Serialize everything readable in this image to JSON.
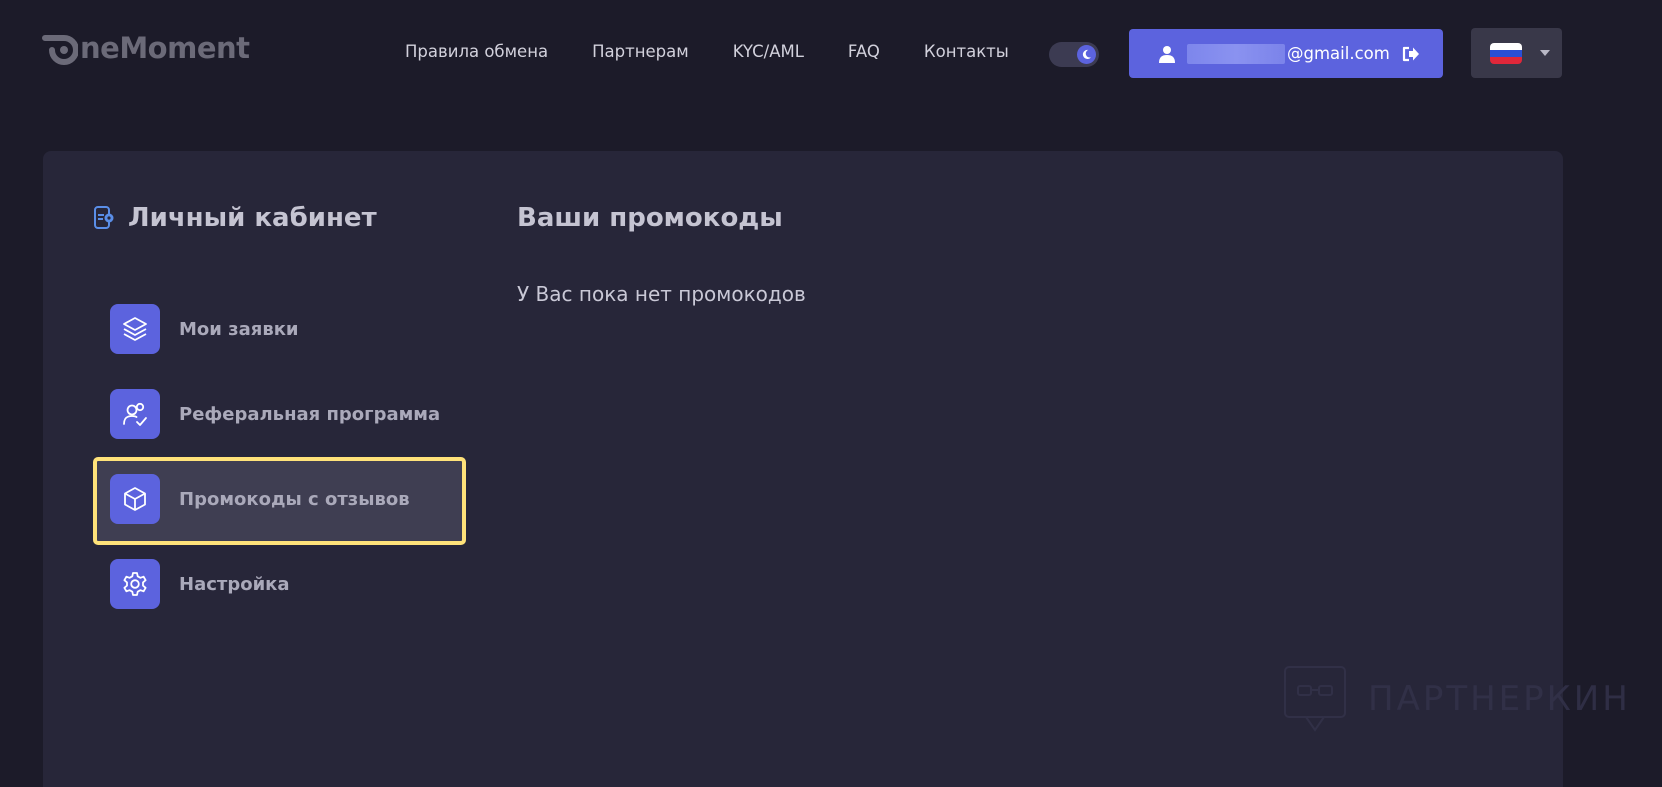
{
  "header": {
    "logo_text": "neMoment",
    "nav": [
      "Правила обмена",
      "Партнерам",
      "KYC/AML",
      "FAQ",
      "Контакты"
    ],
    "theme_toggle": "moon-icon",
    "user": {
      "email_suffix": "@gmail.com"
    },
    "language": "ru"
  },
  "sidebar": {
    "title": "Личный кабинет",
    "items": [
      {
        "label": "Мои заявки",
        "icon": "layers-icon"
      },
      {
        "label": "Реферальная программа",
        "icon": "users-check-icon"
      },
      {
        "label": "Промокоды с отзывов",
        "icon": "box-icon",
        "active": true
      },
      {
        "label": "Настройка",
        "icon": "gear-icon"
      }
    ]
  },
  "main": {
    "title": "Ваши промокоды",
    "empty_text": "У Вас пока нет промокодов"
  },
  "watermark": {
    "text": "ПАРТНЕРКИН"
  },
  "colors": {
    "accent": "#5c63de",
    "background": "#1c1b29",
    "card": "#272639",
    "highlight_border": "#ffe27a"
  }
}
